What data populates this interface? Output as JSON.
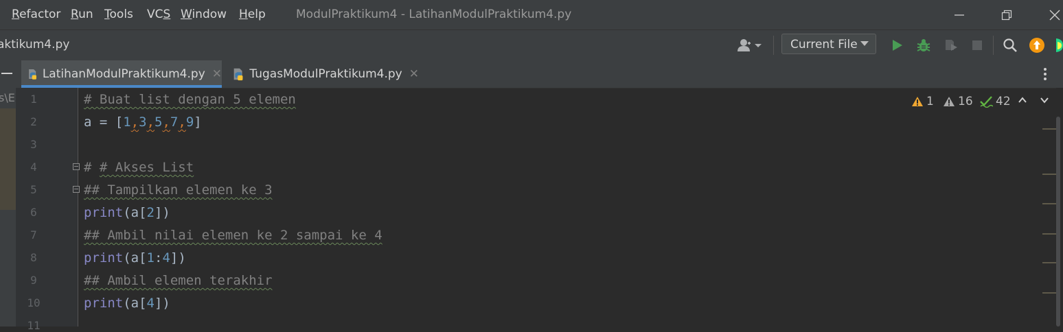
{
  "menu": {
    "items": [
      "Refactor",
      "Run",
      "Tools",
      "VCS",
      "Window",
      "Help"
    ],
    "window_title": "ModulPraktikum4 - LatihanModulPraktikum4.py"
  },
  "nav": {
    "path": "aktikum4.py",
    "run_config": "Current File"
  },
  "tabs": [
    {
      "label": "LatihanModulPraktikum4.py",
      "active": true
    },
    {
      "label": "TugasModulPraktikum4.py",
      "active": false
    }
  ],
  "project": {
    "path_fragment": "s\\E"
  },
  "inspections": {
    "errors": "1",
    "warnings": "16",
    "ok": "42"
  },
  "editor": {
    "line_numbers": [
      "1",
      "2",
      "3",
      "4",
      "5",
      "6",
      "7",
      "8",
      "9",
      "10",
      "11"
    ],
    "lines": {
      "l1": "# Buat list dengan 5 elemen",
      "l4": "# Akses List",
      "l5": "## Tampilkan elemen ke 3",
      "l7": "## Ambil nilai elemen ke 2 sampai ke 4",
      "l9": "## Ambil elemen terakhir"
    },
    "line2": {
      "var": "a = [",
      "n1": "1",
      "n2": "3",
      "n3": "5",
      "n4": "7",
      "n5": "9",
      "close": "]"
    },
    "line6": {
      "fn": "print",
      "pre": "(a[",
      "n": "2",
      "post": "])"
    },
    "line8": {
      "fn": "print",
      "pre": "(a[",
      "n1": "1",
      "colon": ":",
      "n2": "4",
      "post": "])"
    },
    "line10": {
      "fn": "print",
      "pre": "(a[",
      "n": "4",
      "post": "])"
    }
  },
  "colors": {
    "accent": "#4a88c7",
    "run_green": "#499c54",
    "warning_yellow": "#f0a732",
    "update_orange": "#f49810"
  },
  "icons": [
    "user-icon",
    "run-icon",
    "debug-icon",
    "coverage-icon",
    "stop-icon",
    "search-icon",
    "update-icon",
    "minimize-icon",
    "restore-icon",
    "close-icon",
    "python-file-icon",
    "more-vertical-icon",
    "error-icon",
    "warning-icon",
    "check-icon"
  ]
}
